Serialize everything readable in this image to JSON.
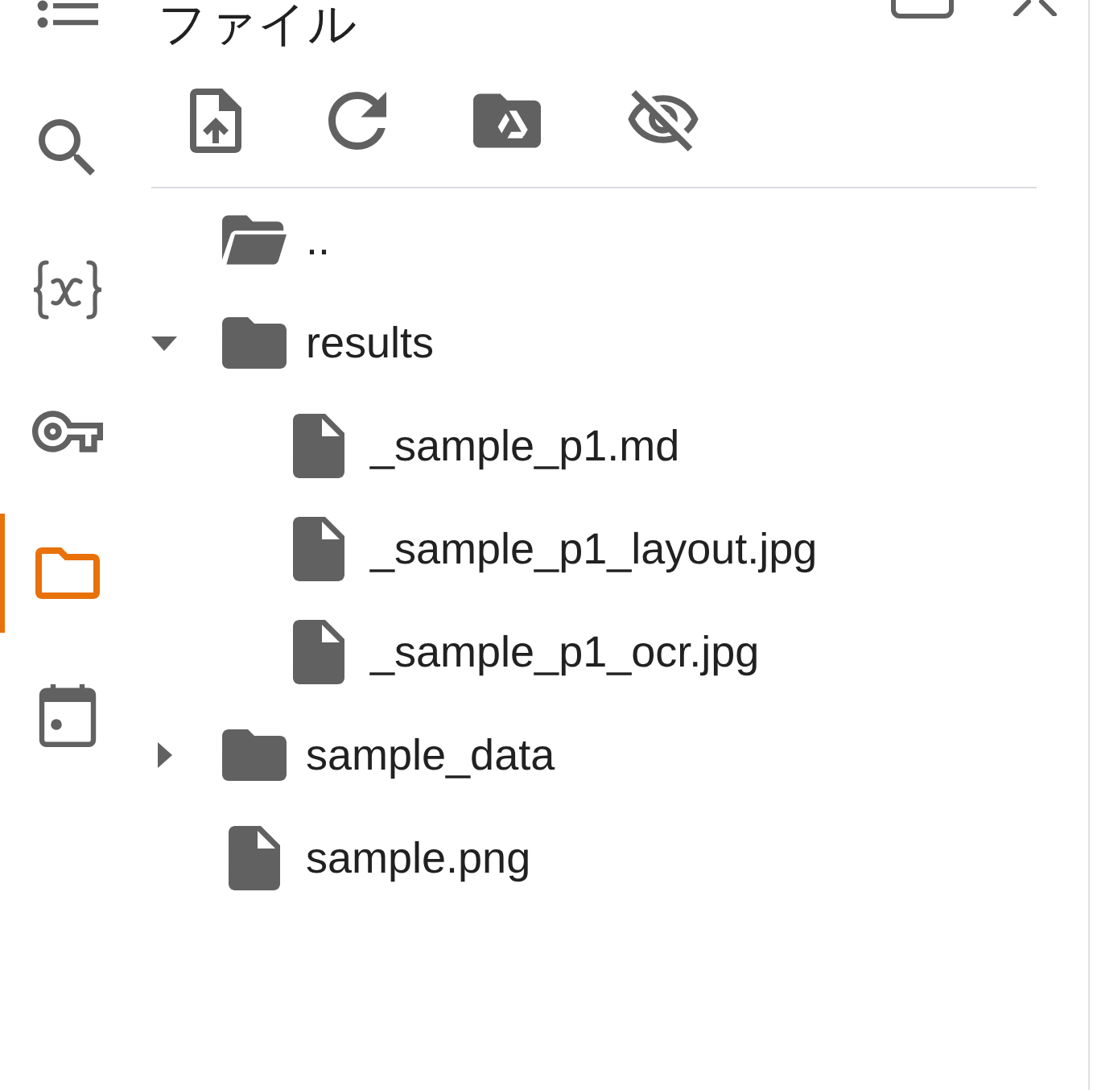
{
  "activity_bar": [
    {
      "kind": "outline",
      "selected": false
    },
    {
      "kind": "search",
      "selected": false
    },
    {
      "kind": "variables",
      "selected": false
    },
    {
      "kind": "secrets",
      "selected": false
    },
    {
      "kind": "files",
      "selected": true
    },
    {
      "kind": "calendar",
      "selected": false
    }
  ],
  "panel": {
    "title": "ファイル"
  },
  "file_tree": [
    {
      "kind": "parent",
      "name": ".."
    },
    {
      "kind": "folder",
      "name": "results",
      "expanded": true,
      "children": [
        {
          "kind": "file",
          "name": "_sample_p1.md"
        },
        {
          "kind": "file",
          "name": "_sample_p1_layout.jpg"
        },
        {
          "kind": "file",
          "name": "_sample_p1_ocr.jpg"
        }
      ]
    },
    {
      "kind": "folder",
      "name": "sample_data",
      "expanded": false
    },
    {
      "kind": "file",
      "name": "sample.png"
    }
  ]
}
